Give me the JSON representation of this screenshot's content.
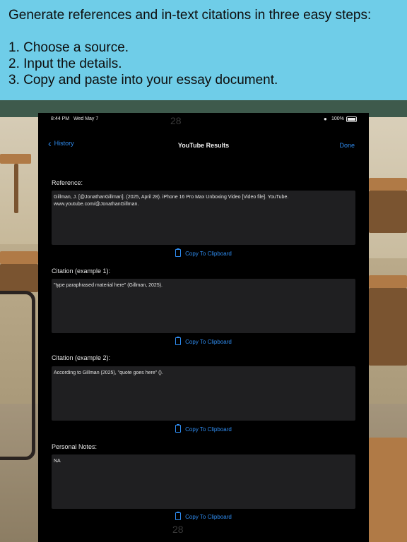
{
  "banner": {
    "headline": "Generate references and in-text citations in three easy steps:",
    "steps": [
      "1. Choose a source.",
      "2. Input the details.",
      "3. Copy and paste into your essay document."
    ]
  },
  "status_bar": {
    "time": "8:44 PM",
    "date": "Wed May 7",
    "date_ghost": "28",
    "battery": "100%"
  },
  "nav": {
    "back_label": "History",
    "title": "YouTube Results",
    "done_label": "Done"
  },
  "sections": {
    "reference": {
      "label": "Reference:",
      "text": "Gillman, J. [@JonathanGillman]. (2025, April 28). iPhone 16 Pro Max Unboxing Video [Video file]. YouTube. www.youtube.com/@JonathanGillman.",
      "copy_label": "Copy To Clipboard"
    },
    "citation1": {
      "label": "Citation (example 1):",
      "text": "\"type paraphrased material here\" (Gillman, 2025).",
      "copy_label": "Copy To Clipboard"
    },
    "citation2": {
      "label": "Citation (example 2):",
      "text": "According to Gillman (2025), \"quote goes here\" ().",
      "copy_label": "Copy To Clipboard"
    },
    "notes": {
      "label": "Personal Notes:",
      "text": "NA",
      "copy_label": "Copy To Clipboard"
    }
  },
  "bottom_ghost": "28",
  "colors": {
    "banner_bg": "#6fcde8",
    "accent": "#2f8cf0",
    "tablet_bg": "#000000",
    "field_bg": "#1f1f21"
  }
}
